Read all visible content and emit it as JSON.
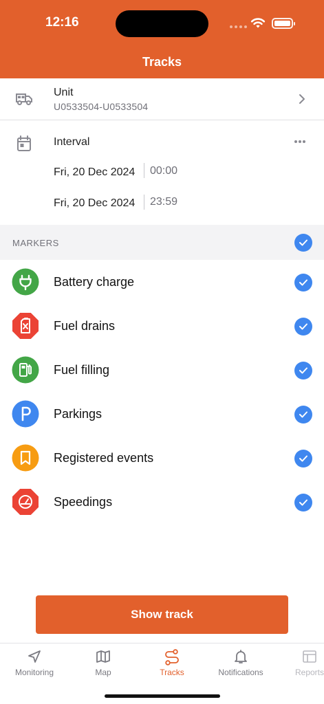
{
  "status": {
    "time": "12:16"
  },
  "header": {
    "title": "Tracks"
  },
  "unit": {
    "label": "Unit",
    "value": "U0533504-U0533504"
  },
  "interval": {
    "label": "Interval",
    "from": {
      "date": "Fri, 20 Dec 2024",
      "time": "00:00"
    },
    "to": {
      "date": "Fri, 20 Dec 2024",
      "time": "23:59"
    }
  },
  "markers": {
    "heading": "MARKERS",
    "items": [
      {
        "label": "Battery charge",
        "icon": "plug-icon",
        "color": "#43A647",
        "checked": true
      },
      {
        "label": "Fuel drains",
        "icon": "fuel-can-icon",
        "color": "#EB4335",
        "checked": true
      },
      {
        "label": "Fuel filling",
        "icon": "fuel-pump-icon",
        "color": "#43A647",
        "checked": true
      },
      {
        "label": "Parkings",
        "icon": "parking-icon",
        "color": "#3F87EF",
        "checked": true
      },
      {
        "label": "Registered events",
        "icon": "bookmark-icon",
        "color": "#F79C12",
        "checked": true
      },
      {
        "label": "Speedings",
        "icon": "speedometer-icon",
        "color": "#EB4335",
        "checked": true
      }
    ]
  },
  "action": {
    "show_track": "Show track"
  },
  "tabs": [
    {
      "label": "Monitoring",
      "icon": "navigation-arrow-icon",
      "active": false
    },
    {
      "label": "Map",
      "icon": "map-icon",
      "active": false
    },
    {
      "label": "Tracks",
      "icon": "route-icon",
      "active": true
    },
    {
      "label": "Notifications",
      "icon": "bell-icon",
      "active": false
    },
    {
      "label": "Reports",
      "icon": "report-icon",
      "active": false
    }
  ],
  "colors": {
    "accent": "#E2602C",
    "check": "#3F87EF"
  }
}
